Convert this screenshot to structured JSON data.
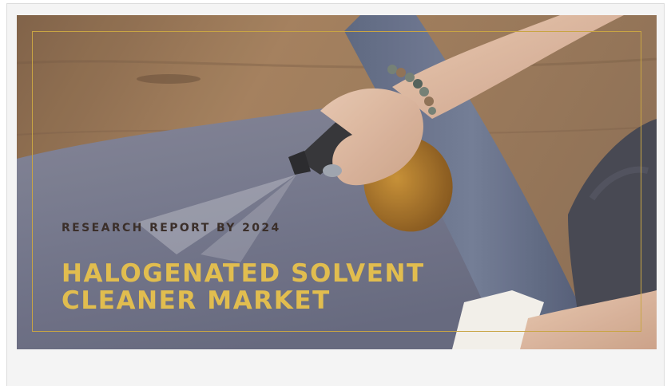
{
  "banner": {
    "subtitle": "RESEARCH REPORT BY 2024",
    "title_line1": "HALOGENATED SOLVENT",
    "title_line2": "CLEANER MARKET",
    "photo_subject": "hand-spraying-bottle-on-yoga-mat",
    "colors": {
      "accent_gold": "#e1bd4f",
      "frame_gold": "#c9a543",
      "subtitle_text": "#3b2f2a"
    }
  }
}
